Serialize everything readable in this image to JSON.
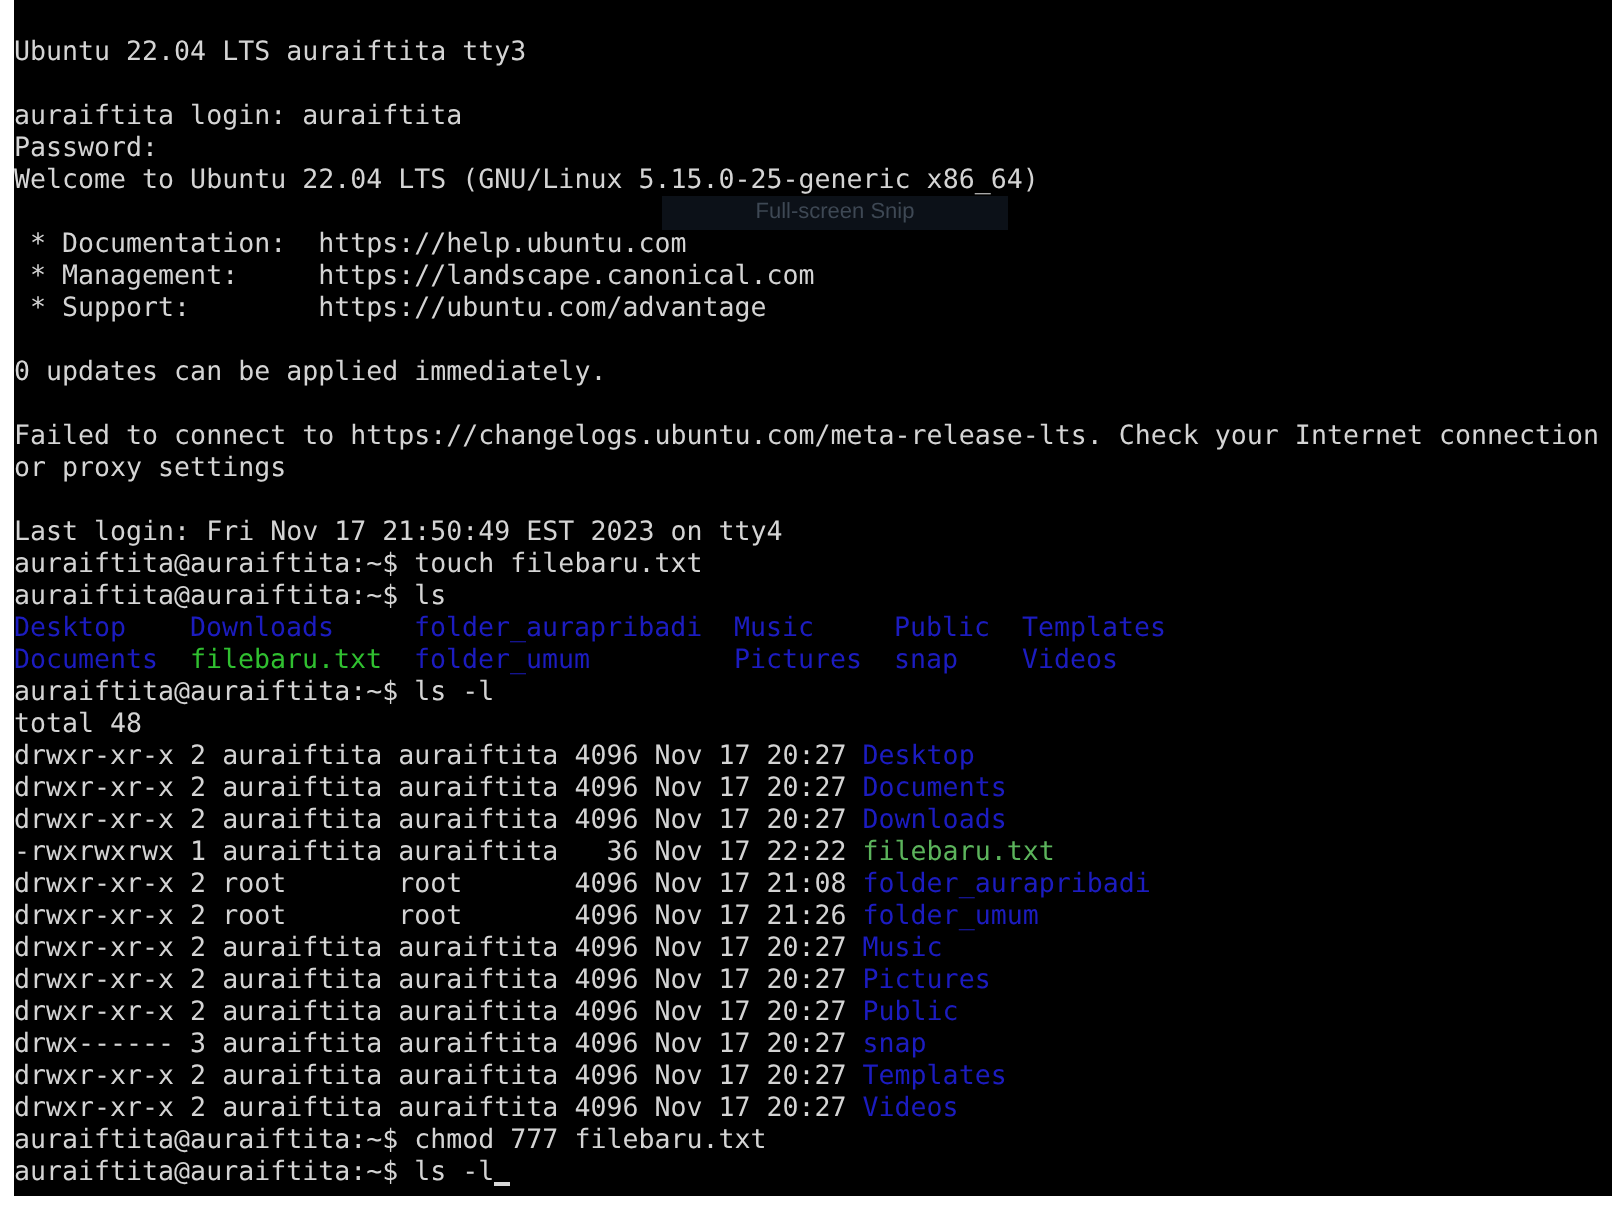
{
  "terminal": {
    "blocks": [
      {
        "lines": [
          {
            "kind": "text",
            "text": "Ubuntu 22.04 LTS auraiftita tty3"
          }
        ]
      },
      {
        "lines": [
          {
            "kind": "text",
            "text": "auraiftita login: auraiftita"
          },
          {
            "kind": "text",
            "text": "Password:"
          },
          {
            "kind": "text",
            "text": "Welcome to Ubuntu 22.04 LTS (GNU/Linux 5.15.0-25-generic x86_64)"
          }
        ]
      },
      {
        "lines": [
          {
            "kind": "text",
            "text": " * Documentation:  https://help.ubuntu.com"
          },
          {
            "kind": "text",
            "text": " * Management:     https://landscape.canonical.com"
          },
          {
            "kind": "text",
            "text": " * Support:        https://ubuntu.com/advantage"
          }
        ]
      },
      {
        "lines": [
          {
            "kind": "text",
            "text": "0 updates can be applied immediately."
          }
        ]
      },
      {
        "lines": [
          {
            "kind": "text",
            "text": "Failed to connect to https://changelogs.ubuntu.com/meta-release-lts. Check your Internet connection"
          },
          {
            "kind": "text",
            "text": "or proxy settings"
          }
        ]
      },
      {
        "lines": [
          {
            "kind": "text",
            "text": "Last login: Fri Nov 17 21:50:49 EST 2023 on tty4"
          },
          {
            "kind": "text",
            "text": "auraiftita@auraiftita:~$ touch filebaru.txt"
          },
          {
            "kind": "text",
            "text": "auraiftita@auraiftita:~$ ls"
          },
          {
            "kind": "grid",
            "items": [
              {
                "name": "Desktop",
                "color": "#1c1cc0"
              },
              {
                "name": "Downloads",
                "color": "#1c1cc0"
              },
              {
                "name": "folder_aurapribadi",
                "color": "#1c1cc0"
              },
              {
                "name": "Music",
                "color": "#1c1cc0"
              },
              {
                "name": "Public",
                "color": "#1c1cc0"
              },
              {
                "name": "Templates",
                "color": "#1c1cc0"
              }
            ]
          },
          {
            "kind": "grid",
            "items": [
              {
                "name": "Documents",
                "color": "#1c1cc0"
              },
              {
                "name": "filebaru.txt",
                "color": "#30c030"
              },
              {
                "name": "folder_umum",
                "color": "#1c1cc0"
              },
              {
                "name": "Pictures",
                "color": "#1c1cc0"
              },
              {
                "name": "snap",
                "color": "#1c1cc0"
              },
              {
                "name": "Videos",
                "color": "#1c1cc0"
              }
            ]
          },
          {
            "kind": "text",
            "text": "auraiftita@auraiftita:~$ ls -l"
          },
          {
            "kind": "text",
            "text": "total 48"
          },
          {
            "kind": "long",
            "text": "drwxr-xr-x 2 auraiftita auraiftita 4096 Nov 17 20:27",
            "name": "Desktop",
            "color": "#1c1cc0"
          },
          {
            "kind": "long",
            "text": "drwxr-xr-x 2 auraiftita auraiftita 4096 Nov 17 20:27",
            "name": "Documents",
            "color": "#1c1cc0"
          },
          {
            "kind": "long",
            "text": "drwxr-xr-x 2 auraiftita auraiftita 4096 Nov 17 20:27",
            "name": "Downloads",
            "color": "#1c1cc0"
          },
          {
            "kind": "long",
            "text": "-rwxrwxrwx 1 auraiftita auraiftita   36 Nov 17 22:22",
            "name": "filebaru.txt",
            "color": "#5cb45c"
          },
          {
            "kind": "long",
            "text": "drwxr-xr-x 2 root       root       4096 Nov 17 21:08",
            "name": "folder_aurapribadi",
            "color": "#1c1cc0"
          },
          {
            "kind": "long",
            "text": "drwxr-xr-x 2 root       root       4096 Nov 17 21:26",
            "name": "folder_umum",
            "color": "#1c1cc0"
          },
          {
            "kind": "long",
            "text": "drwxr-xr-x 2 auraiftita auraiftita 4096 Nov 17 20:27",
            "name": "Music",
            "color": "#1c1cc0"
          },
          {
            "kind": "long",
            "text": "drwxr-xr-x 2 auraiftita auraiftita 4096 Nov 17 20:27",
            "name": "Pictures",
            "color": "#1c1cc0"
          },
          {
            "kind": "long",
            "text": "drwxr-xr-x 2 auraiftita auraiftita 4096 Nov 17 20:27",
            "name": "Public",
            "color": "#1c1cc0"
          },
          {
            "kind": "long",
            "text": "drwx------ 3 auraiftita auraiftita 4096 Nov 17 20:27",
            "name": "snap",
            "color": "#1c1cc0"
          },
          {
            "kind": "long",
            "text": "drwxr-xr-x 2 auraiftita auraiftita 4096 Nov 17 20:27",
            "name": "Templates",
            "color": "#1c1cc0"
          },
          {
            "kind": "long",
            "text": "drwxr-xr-x 2 auraiftita auraiftita 4096 Nov 17 20:27",
            "name": "Videos",
            "color": "#1c1cc0"
          },
          {
            "kind": "text",
            "text": "auraiftita@auraiftita:~$ chmod 777 filebaru.txt"
          },
          {
            "kind": "cursor",
            "text": "auraiftita@auraiftita:~$ ls -l"
          }
        ]
      }
    ]
  },
  "snip_tooltip": {
    "text": "Full-screen Snip"
  }
}
